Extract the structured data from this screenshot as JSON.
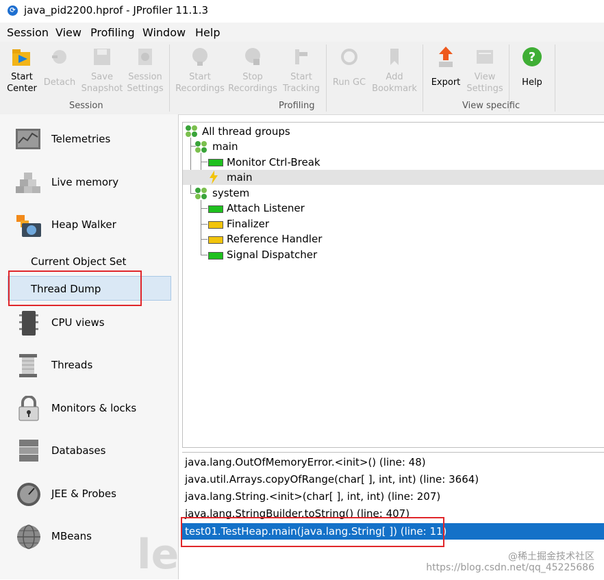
{
  "window": {
    "title": "java_pid2200.hprof - JProfiler 11.1.3"
  },
  "menu": [
    "Session",
    "View",
    "Profiling",
    "Window",
    "Help"
  ],
  "toolbar": {
    "buttons": [
      {
        "line1": "Start",
        "line2": "Center",
        "enabled": true,
        "icon": "start-center-icon"
      },
      {
        "line1": "Detach",
        "line2": "",
        "enabled": false,
        "icon": "detach-icon"
      },
      {
        "line1": "Save",
        "line2": "Snapshot",
        "enabled": false,
        "icon": "save-snapshot-icon"
      },
      {
        "line1": "Session",
        "line2": "Settings",
        "enabled": false,
        "icon": "session-settings-icon"
      },
      {
        "line1": "Start",
        "line2": "Recordings",
        "enabled": false,
        "icon": "start-recordings-icon"
      },
      {
        "line1": "Stop",
        "line2": "Recordings",
        "enabled": false,
        "icon": "stop-recordings-icon"
      },
      {
        "line1": "Start",
        "line2": "Tracking",
        "enabled": false,
        "icon": "start-tracking-icon"
      },
      {
        "line1": "Run GC",
        "line2": "",
        "enabled": false,
        "icon": "run-gc-icon"
      },
      {
        "line1": "Add",
        "line2": "Bookmark",
        "enabled": false,
        "icon": "add-bookmark-icon"
      },
      {
        "line1": "Export",
        "line2": "",
        "enabled": true,
        "icon": "export-icon"
      },
      {
        "line1": "View",
        "line2": "Settings",
        "enabled": false,
        "icon": "view-settings-icon"
      },
      {
        "line1": "Help",
        "line2": "",
        "enabled": true,
        "icon": "help-icon"
      }
    ],
    "groups": [
      "Session",
      "Profiling",
      "View specific"
    ]
  },
  "sidebar": {
    "items": [
      {
        "label": "Telemetries",
        "icon": "telemetries-icon"
      },
      {
        "label": "Live memory",
        "icon": "live-memory-icon"
      },
      {
        "label": "Heap Walker",
        "icon": "heap-walker-icon"
      },
      {
        "label": "CPU views",
        "icon": "cpu-views-icon"
      },
      {
        "label": "Threads",
        "icon": "threads-icon"
      },
      {
        "label": "Monitors & locks",
        "icon": "monitors-locks-icon"
      },
      {
        "label": "Databases",
        "icon": "databases-icon"
      },
      {
        "label": "JEE & Probes",
        "icon": "jee-probes-icon"
      },
      {
        "label": "MBeans",
        "icon": "mbeans-icon"
      }
    ],
    "subitems": [
      "Current Object Set",
      "Thread Dump"
    ],
    "selected": "Thread Dump",
    "watermark": "ler"
  },
  "thread_tree": {
    "root": "All thread groups",
    "groups": [
      {
        "name": "main",
        "threads": [
          {
            "name": "Monitor Ctrl-Break",
            "state": "runnable",
            "color": "#1fc01f"
          },
          {
            "name": "main",
            "state": "current",
            "color": "#f2c40c",
            "selected": true
          }
        ]
      },
      {
        "name": "system",
        "threads": [
          {
            "name": "Attach Listener",
            "state": "runnable",
            "color": "#1fc01f"
          },
          {
            "name": "Finalizer",
            "state": "waiting",
            "color": "#f2c40c"
          },
          {
            "name": "Reference Handler",
            "state": "waiting",
            "color": "#f2c40c"
          },
          {
            "name": "Signal Dispatcher",
            "state": "runnable",
            "color": "#1fc01f"
          }
        ]
      }
    ]
  },
  "stack_trace": {
    "frames": [
      "java.lang.OutOfMemoryError.<init>() (line: 48)",
      "java.util.Arrays.copyOfRange(char[ ], int, int) (line: 3664)",
      "java.lang.String.<init>(char[ ], int, int) (line: 207)",
      "java.lang.StringBuilder.toString() (line: 407)",
      "test01.TestHeap.main(java.lang.String[ ]) (line: 11)"
    ],
    "selected_index": 4
  },
  "credits": {
    "line1": "@稀土掘金技术社区",
    "line2": "https://blog.csdn.net/qq_45225686"
  },
  "colors": {
    "selection": "#1471c8",
    "highlight": "#e0262a",
    "runnable": "#1fc01f",
    "waiting": "#f2c40c"
  }
}
